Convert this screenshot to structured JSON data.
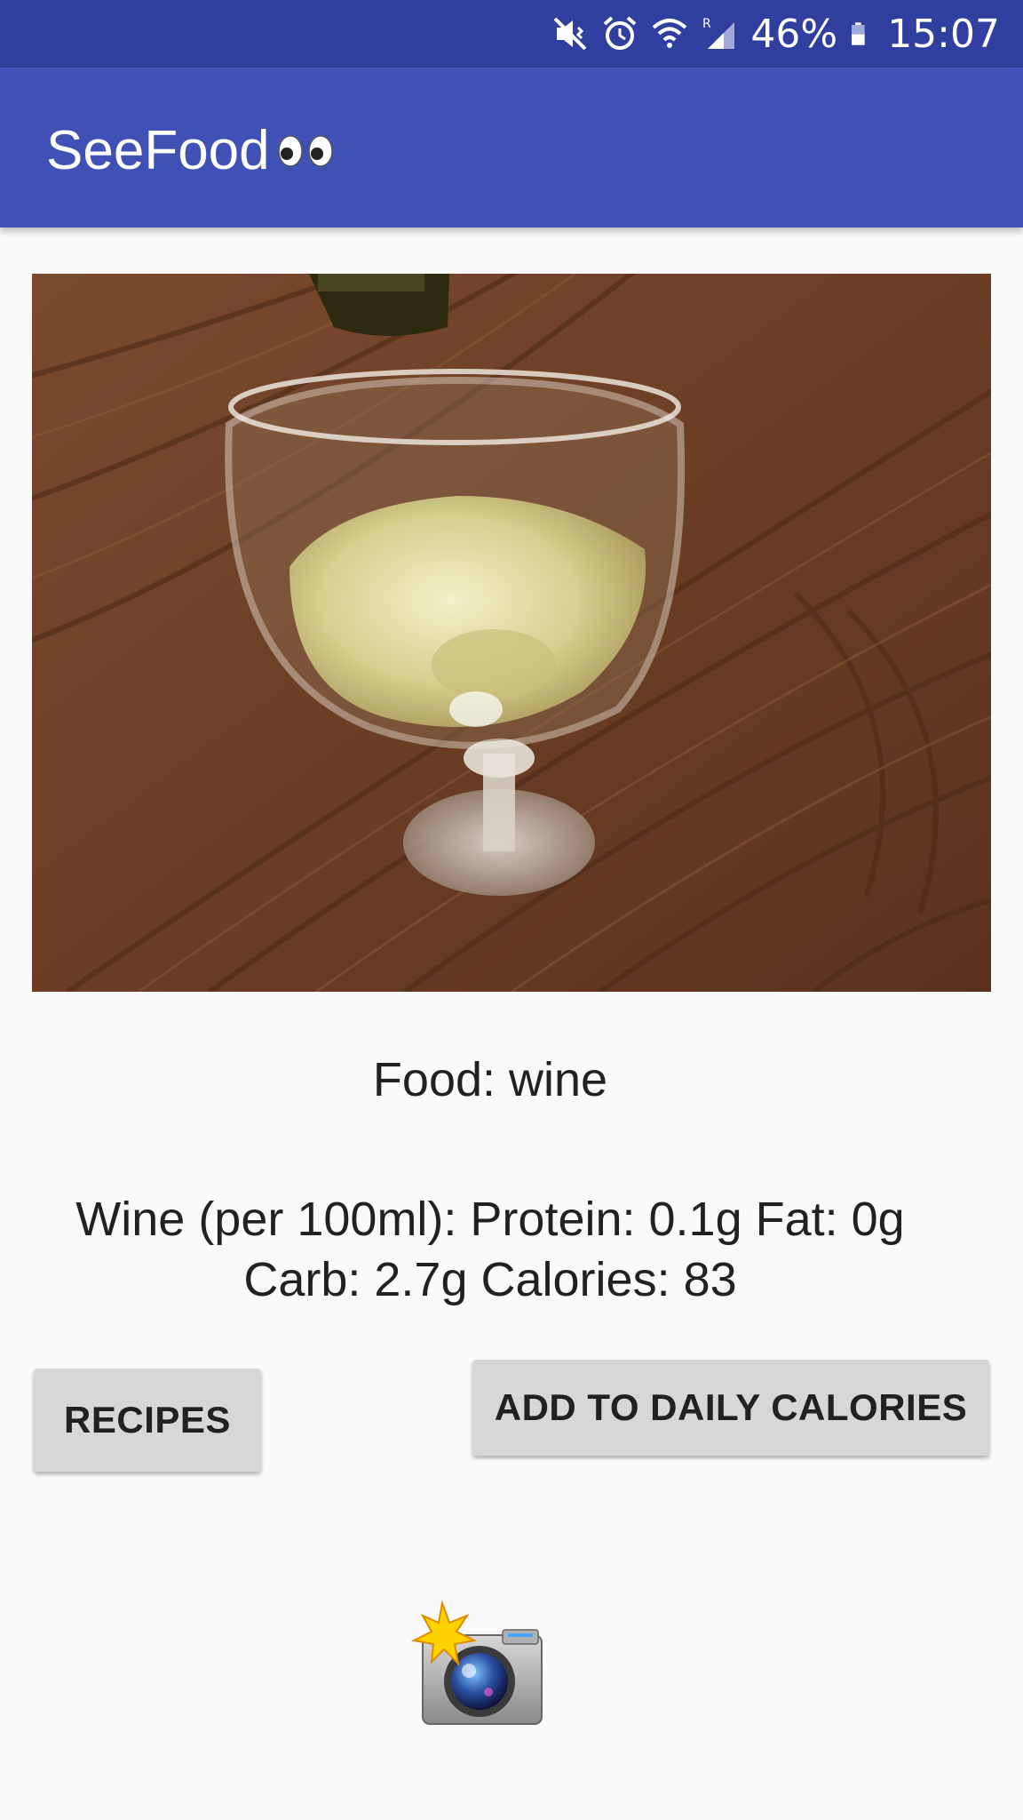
{
  "status_bar": {
    "battery": "46%",
    "time": "15:07",
    "icons": [
      "mute-vibrate-icon",
      "alarm-icon",
      "wifi-icon",
      "signal-roaming-icon",
      "battery-icon"
    ]
  },
  "app_bar": {
    "title": "SeeFood",
    "title_decoration": "eyes-emoji-icon"
  },
  "photo": {
    "subject": "glass-of-white-wine-on-wooden-table"
  },
  "result": {
    "food_label": "Food: wine",
    "nutrition_line1": "Wine (per 100ml): Protein: 0.1g Fat: 0g",
    "nutrition_line2": "Carb: 2.7g Calories: 83"
  },
  "buttons": {
    "recipes": "RECIPES",
    "add_daily": "ADD TO DAILY CALORIES"
  },
  "camera": {
    "icon": "camera-flash-icon"
  },
  "colors": {
    "status_bar": "#303f9f",
    "app_bar": "#3f51b5",
    "background": "#fafafa",
    "button": "#d6d7d7"
  }
}
